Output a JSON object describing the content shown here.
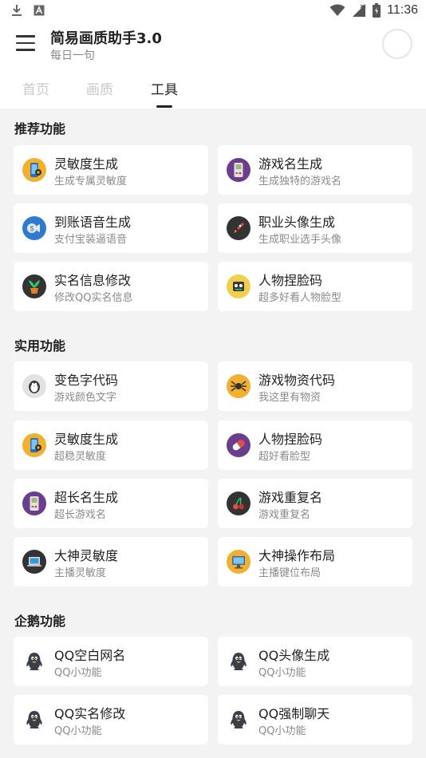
{
  "status_bar": {
    "time": "11:36"
  },
  "header": {
    "title": "简易画质助手3.0",
    "subtitle": "每日一句"
  },
  "tabs": [
    {
      "label": "首页",
      "active": false
    },
    {
      "label": "画质",
      "active": false
    },
    {
      "label": "工具",
      "active": true
    }
  ],
  "sections": [
    {
      "title": "推荐功能",
      "items": [
        {
          "title": "灵敏度生成",
          "subtitle": "生成专属灵敏度",
          "icon": "phone-settings-icon"
        },
        {
          "title": "游戏名生成",
          "subtitle": "生成独特的游戏名",
          "icon": "gameboy-icon"
        },
        {
          "title": "到账语音生成",
          "subtitle": "支付宝装逼语音",
          "icon": "coin-speaker-icon"
        },
        {
          "title": "职业头像生成",
          "subtitle": "生成职业选手头像",
          "icon": "rocket-icon"
        },
        {
          "title": "实名信息修改",
          "subtitle": "修改QQ实名信息",
          "icon": "plant-icon"
        },
        {
          "title": "人物捏脸码",
          "subtitle": "超多好看人物脸型",
          "icon": "robot-face-icon"
        }
      ]
    },
    {
      "title": "实用功能",
      "items": [
        {
          "title": "变色字代码",
          "subtitle": "游戏颜色文字",
          "icon": "bird-icon"
        },
        {
          "title": "游戏物资代码",
          "subtitle": "我这里有物资",
          "icon": "spider-icon"
        },
        {
          "title": "灵敏度生成",
          "subtitle": "超稳灵敏度",
          "icon": "phone-settings-icon"
        },
        {
          "title": "人物捏脸码",
          "subtitle": "超好看脸型",
          "icon": "pill-icon"
        },
        {
          "title": "超长名生成",
          "subtitle": "超长游戏名",
          "icon": "gameboy-icon"
        },
        {
          "title": "游戏重复名",
          "subtitle": "游戏重复名",
          "icon": "cherry-icon"
        },
        {
          "title": "大神灵敏度",
          "subtitle": "主播灵敏度",
          "icon": "laptop-icon"
        },
        {
          "title": "大神操作布局",
          "subtitle": "主播键位布局",
          "icon": "monitor-icon"
        }
      ]
    },
    {
      "title": "企鹅功能",
      "items": [
        {
          "title": "QQ空白网名",
          "subtitle": "QQ小功能",
          "icon": "penguin-icon"
        },
        {
          "title": "QQ头像生成",
          "subtitle": "QQ小功能",
          "icon": "penguin-icon"
        },
        {
          "title": "QQ实名修改",
          "subtitle": "QQ小功能",
          "icon": "penguin-icon"
        },
        {
          "title": "QQ强制聊天",
          "subtitle": "QQ小功能",
          "icon": "penguin-icon"
        }
      ]
    }
  ]
}
